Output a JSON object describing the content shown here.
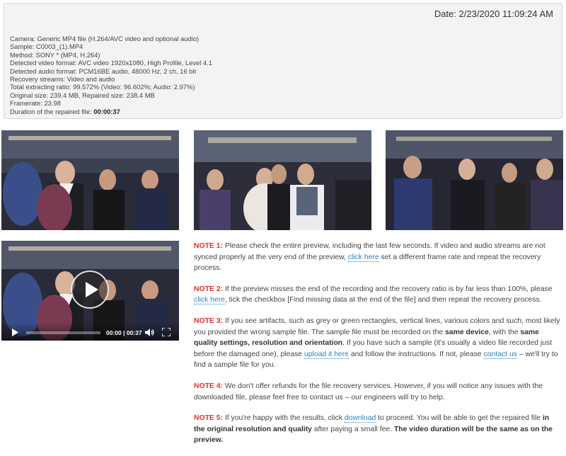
{
  "info": {
    "date": "Date: 2/23/2020 11:09:24 AM",
    "camera": "Camera:  Generic MP4 file (H.264/AVC video and optional audio)",
    "sample": "Sample: C0003_(1).MP4",
    "method": "Method: SONY * (MP4, H.264)",
    "video_format": "Detected video format: AVC video 1920x1080, High Profile, Level 4.1",
    "audio_format": "Detected audio format: PCM16BE audio, 48000 Hz, 2 ch, 16 bit",
    "streams": "Recovery streams: Video and audio",
    "ratio": "Total extracting ratio: 99.572% (Video: 96.602%; Audio: 2.97%)",
    "sizes": "Original size: 239.4 MB, Repaired size: 238.4 MB",
    "framerate": "Framerate: 23.98",
    "duration_label": "Duration of the repaired file: ",
    "duration_value": "00:00:37"
  },
  "player": {
    "time": "00:00 | 00:37",
    "progress": 0
  },
  "notes": {
    "n1": {
      "label": "NOTE 1:",
      "t1": " Please check the entire preview, including the last few seconds. If video and audio streams are not synced properly at the very end of the preview, ",
      "link": "click here",
      "t2": " set a different frame rate and repeat the recovery process."
    },
    "n2": {
      "label": "NOTE 2:",
      "t1": " If the preview misses the end of the recording and the recovery ratio is by far less than 100%, please ",
      "link": "click here",
      "t2": ", tick the checkbox [Find missing data at the end of the file] and then repeat the recovery process."
    },
    "n3": {
      "label": "NOTE 3:",
      "t1": " If you see artifacts, such as grey or green rectangles, vertical lines, various colors and such, most likely you provided the wrong sample file. The sample file must be recorded on the ",
      "b1": "same device",
      "t2": ", with the ",
      "b2": "same quality settings, resolution and orientation",
      "t3": ". If you have such a sample (it's usually a video file recorded just before the damaged one), please ",
      "link1": "upload it here",
      "t4": " and follow the instructions. If not, please ",
      "link2": "contact us",
      "t5": " – we'll try to find a sample file for you."
    },
    "n4": {
      "label": "NOTE 4:",
      "t1": " We don't offer refunds for the file recovery services. However, if you will notice any issues with the downloaded file, please feel free to contact us – our engineers will try to help."
    },
    "n5": {
      "label": "NOTE 5:",
      "t1": " If you're happy with the results, click ",
      "link": "download",
      "t2": " to proceed. You will be able to get the repaired file ",
      "b1": "in the original resolution and quality",
      "t3": " after paying a small fee. ",
      "b2": "The video duration will be the same as on the preview."
    }
  },
  "colors": {
    "note_label": "#e0332f",
    "link": "#2a7fc0"
  }
}
